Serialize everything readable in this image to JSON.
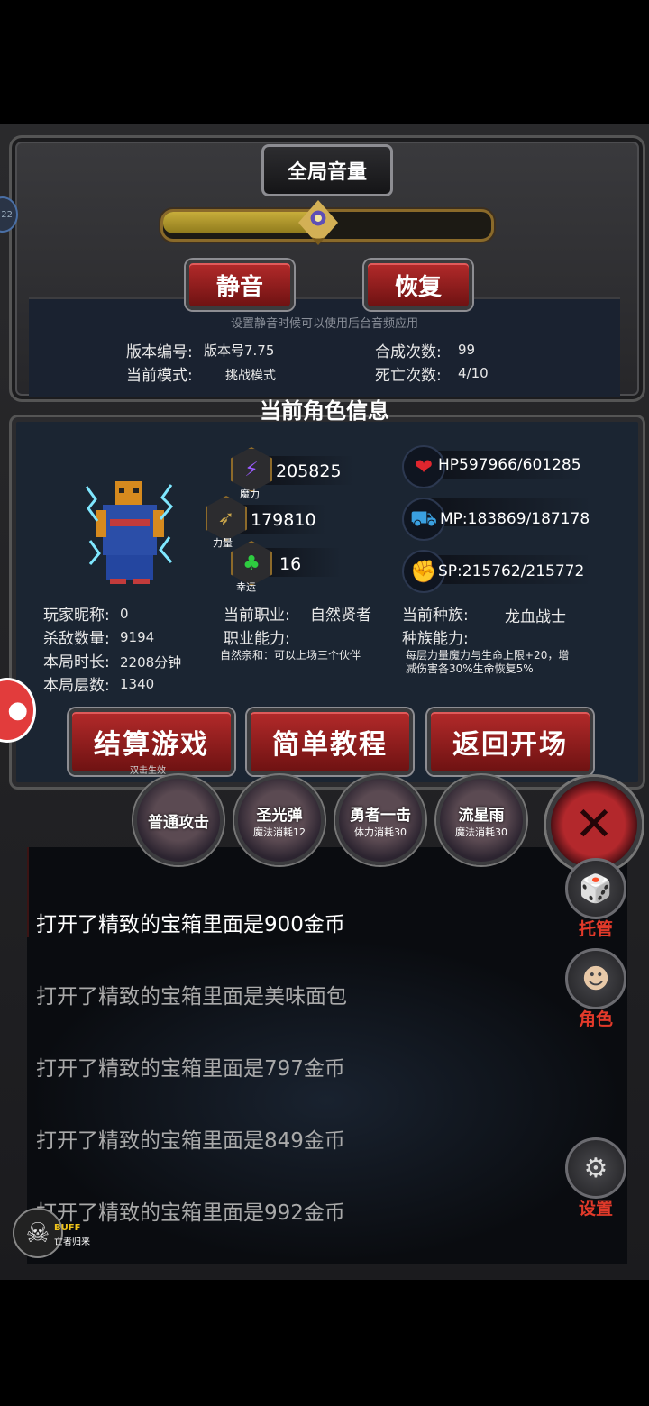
{
  "settings": {
    "volume_title": "全局音量",
    "volume_level": 0.48,
    "mute_label": "静音",
    "restore_label": "恢复",
    "mute_hint": "设置静音时候可以使用后台音频应用",
    "version_label": "版本编号:",
    "version_value": "版本号7.75",
    "mode_label": "当前模式:",
    "mode_value": "挑战模式",
    "synth_label": "合成次数:",
    "synth_value": "99",
    "death_label": "死亡次数:",
    "death_value": "4/10",
    "badge_text": "22"
  },
  "character": {
    "title": "当前角色信息",
    "magic_value": "205825",
    "magic_caption": "魔力",
    "strength_value": "179810",
    "strength_caption": "力量",
    "luck_value": "16",
    "luck_caption": "幸运",
    "hp_value": "HP597966/601285",
    "mp_value": "MP:183869/187178",
    "sp_value": "SP:215762/215772",
    "nickname_label": "玩家昵称:",
    "nickname_value": "0",
    "kills_label": "杀敌数量:",
    "kills_value": "9194",
    "time_label": "本局时长:",
    "time_value": "2208分钟",
    "floor_label": "本局层数:",
    "floor_value": "1340",
    "job_label": "当前职业:",
    "job_value": "自然贤者",
    "job_ability_label": "职业能力:",
    "job_ability_desc": "自然亲和：可以上场三个伙伴",
    "race_label": "当前种族:",
    "race_value": "龙血战士",
    "race_ability_label": "种族能力:",
    "race_ability_desc_1": "每层力量魔力与生命上限+20，增",
    "race_ability_desc_2": "减伤害各30%生命恢复5%"
  },
  "actions": {
    "settle_label": "结算游戏",
    "settle_hint": "双击生效",
    "tutorial_label": "简单教程",
    "return_label": "返回开场"
  },
  "skills": [
    {
      "name": "普通攻击",
      "cost": ""
    },
    {
      "name": "圣光弹",
      "cost": "魔法消耗12"
    },
    {
      "name": "勇者一击",
      "cost": "体力消耗30"
    },
    {
      "name": "流星雨",
      "cost": "魔法消耗30"
    }
  ],
  "log": [
    "打开了精致的宝箱里面是900金币",
    "打开了精致的宝箱里面是美味面包",
    "打开了精致的宝箱里面是797金币",
    "打开了精致的宝箱里面是849金币",
    "打开了精致的宝箱里面是992金币"
  ],
  "side": {
    "auto_label": "托管",
    "role_label": "角色",
    "settings_label": "设置"
  },
  "buff": {
    "label": "BUFF",
    "name": "亡者归来"
  },
  "colors": {
    "accent_red": "#b32a2a",
    "side_label": "#e23a2a",
    "volume_gold": "#c7ad3b"
  }
}
